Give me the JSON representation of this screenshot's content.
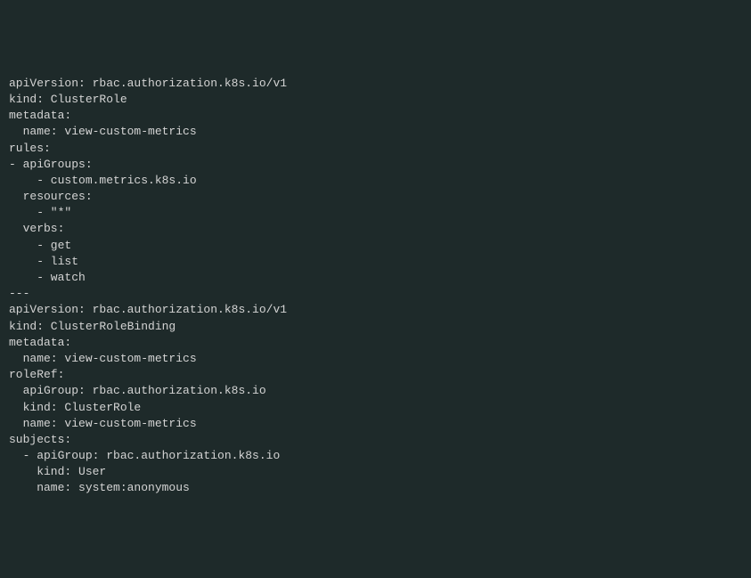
{
  "lines": [
    "apiVersion: rbac.authorization.k8s.io/v1",
    "kind: ClusterRole",
    "metadata:",
    "  name: view-custom-metrics",
    "rules:",
    "- apiGroups:",
    "    - custom.metrics.k8s.io",
    "  resources:",
    "    - \"*\"",
    "  verbs:",
    "    - get",
    "    - list",
    "    - watch",
    "---",
    "apiVersion: rbac.authorization.k8s.io/v1",
    "kind: ClusterRoleBinding",
    "metadata:",
    "  name: view-custom-metrics",
    "roleRef:",
    "  apiGroup: rbac.authorization.k8s.io",
    "  kind: ClusterRole",
    "  name: view-custom-metrics",
    "subjects:",
    "  - apiGroup: rbac.authorization.k8s.io",
    "    kind: User",
    "    name: system:anonymous"
  ]
}
